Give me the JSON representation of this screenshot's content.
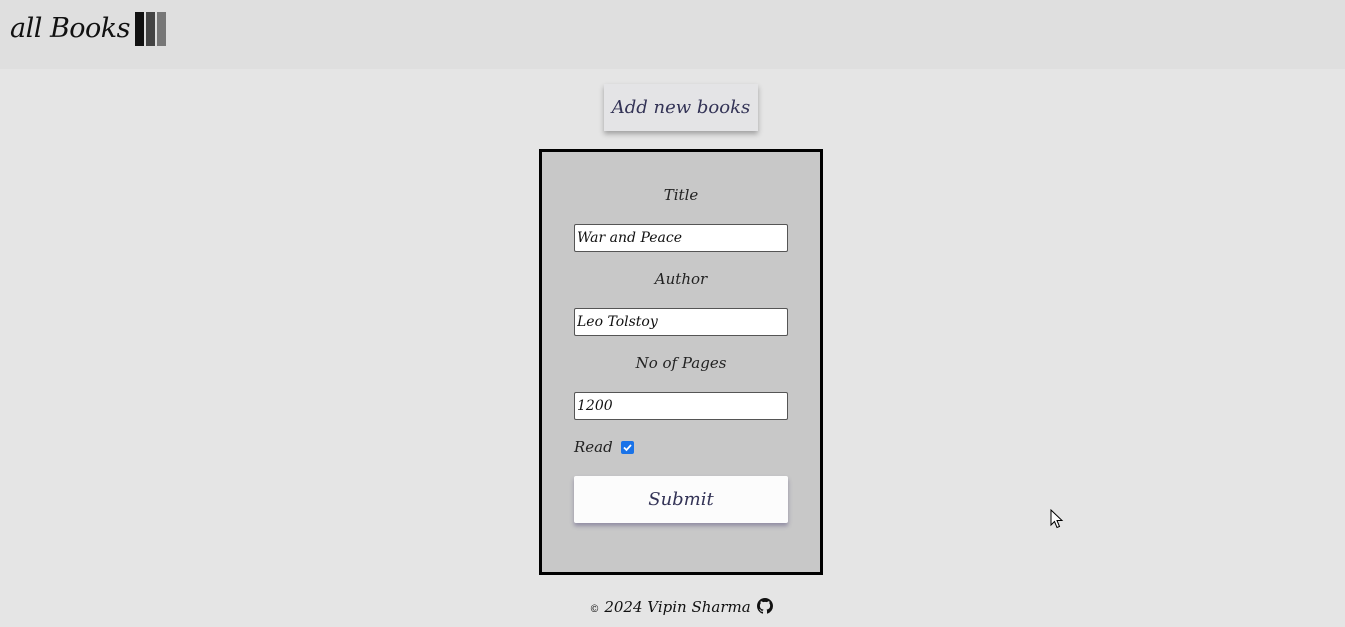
{
  "header": {
    "title": "all Books",
    "icon": "books-icon"
  },
  "main": {
    "add_button_label": "Add new books"
  },
  "form": {
    "title_label": "Title",
    "title_value": "War and Peace",
    "author_label": "Author",
    "author_value": "Leo Tolstoy",
    "pages_label": "No of Pages",
    "pages_value": "1200",
    "read_label": "Read",
    "read_checked": true,
    "submit_label": "Submit"
  },
  "footer": {
    "copyright_symbol": "©",
    "text": "2024 Vipin Sharma",
    "icon": "github-icon"
  },
  "colors": {
    "page_bg": "#e5e5e5",
    "header_bg": "#dfdfdf",
    "card_bg": "#c8c8c8",
    "button_text": "#333356",
    "checkbox": "#1a73e8"
  }
}
